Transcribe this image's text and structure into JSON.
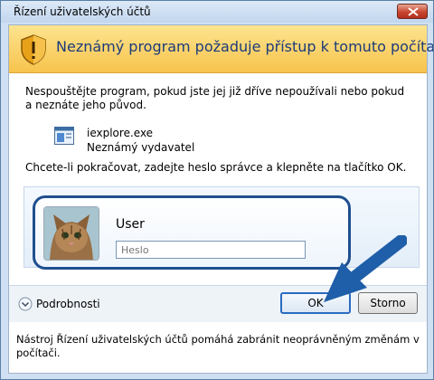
{
  "window": {
    "title": "Řízení uživatelských účtů"
  },
  "banner": {
    "title": "Neznámý program požaduje přístup k tomuto počítači.",
    "icon": "shield-warning-icon"
  },
  "body": {
    "description": "Nespouštějte program, pokud jste jej již dříve nepoužívali nebo pokud a neznáte jeho původ.",
    "program_name": "iexplore.exe",
    "publisher": "Neznámý vydavatel",
    "instruction": "Chcete-li pokračovat, zadejte heslo správce a klepněte na tlačítko OK."
  },
  "credentials": {
    "username": "User",
    "password_placeholder": "Heslo",
    "password_value": ""
  },
  "footer": {
    "details_label": "Podrobnosti",
    "ok_label": "OK",
    "cancel_label": "Storno",
    "footnote": "Nástroj Řízení uživatelských účtů pomáhá zabránit neoprávněným změnám v počítači."
  },
  "colors": {
    "banner": "#f7c34c",
    "accent_border": "#1f4f8f",
    "arrow": "#1f5ea8"
  }
}
